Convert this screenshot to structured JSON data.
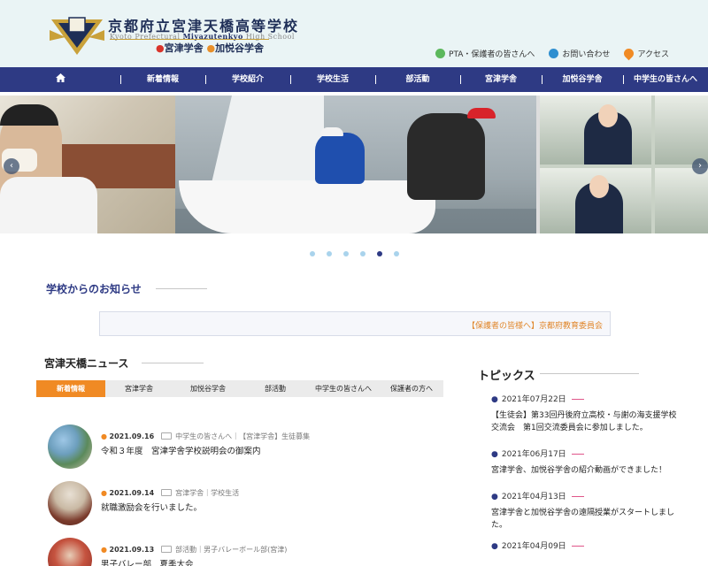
{
  "header": {
    "school_name": "京都府立宮津天橋高等学校",
    "sub_name_1": "Kyoto Prefectural",
    "sub_name_2": "Miyazutenkyo",
    "sub_name_3": "High School",
    "campus_1": "宮津学舎",
    "campus_2": "加悦谷学舎",
    "utility_links": [
      {
        "label": "PTA・保護者の皆さんへ",
        "icon": "person-icon"
      },
      {
        "label": "お問い合わせ",
        "icon": "phone-icon"
      },
      {
        "label": "アクセス",
        "icon": "map-pin-icon"
      }
    ]
  },
  "nav": {
    "home_icon": "home-icon",
    "items": [
      "新着情報",
      "学校紹介",
      "学校生活",
      "部活動",
      "宮津学舎",
      "加悦谷学舎",
      "中学生の皆さんへ"
    ]
  },
  "slider": {
    "slides_total": 6,
    "active_slide": 5,
    "prev_label": "‹",
    "next_label": "›"
  },
  "notice": {
    "title": "学校からのお知らせ",
    "text": "【保護者の皆様へ】京都府教育委員会"
  },
  "news": {
    "title": "宮津天橋ニュース",
    "tabs": [
      "新着情報",
      "宮津学舎",
      "加悦谷学舎",
      "部活動",
      "中学生の皆さんへ",
      "保護者の方へ"
    ],
    "active_tab": 0,
    "items": [
      {
        "date": "2021.09.16",
        "category": "中学生の皆さんへ｜【宮津学舎】生徒募集",
        "title": "令和３年度　宮津学舎学校説明会の御案内"
      },
      {
        "date": "2021.09.14",
        "category": "宮津学舎｜学校生活",
        "title": "就職激励会を行いました。"
      },
      {
        "date": "2021.09.13",
        "category": "部活動｜男子バレーボール部(宮津)",
        "title": "男子バレー部　夏季大会"
      }
    ]
  },
  "topics": {
    "title": "トピックス",
    "items": [
      {
        "date": "2021年07月22日",
        "text": "【生徒会】第33回丹後府立高校・与謝の海支援学校交流会　第1回交流委員会に参加しました。"
      },
      {
        "date": "2021年06月17日",
        "text": "宮津学舎、加悦谷学舎の紹介動画ができました！"
      },
      {
        "date": "2021年04月13日",
        "text": "宮津学舎と加悦谷学舎の遠隔授業がスタートしました。"
      },
      {
        "date": "2021年04月09日",
        "text": ""
      }
    ]
  },
  "colors": {
    "nav_bg": "#2e3a84",
    "accent_orange": "#f08a24",
    "header_bg": "#eaf4f5"
  }
}
